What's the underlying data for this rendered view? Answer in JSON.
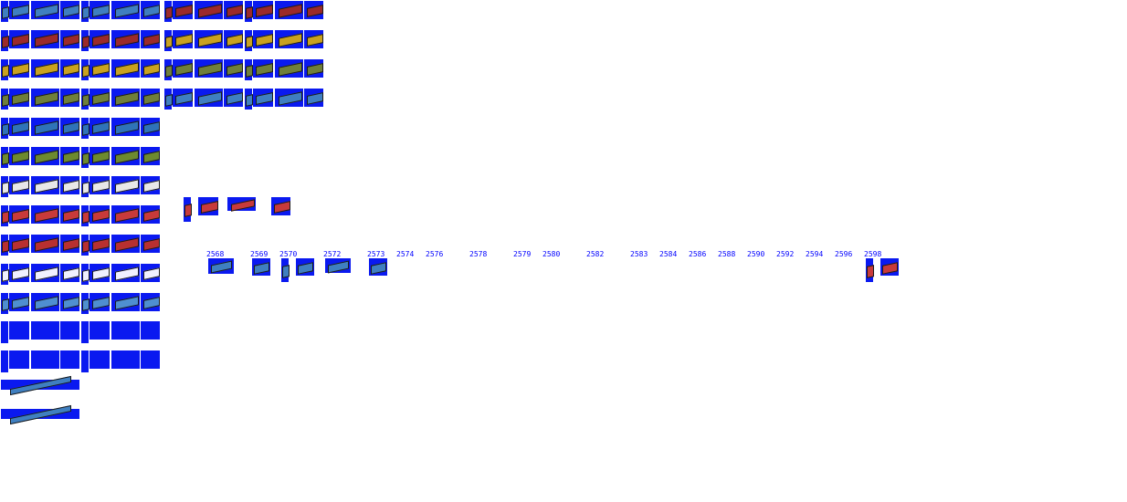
{
  "sprite_sheet": {
    "background_color": "#ffffff",
    "sprite_background_color": "#0a19f0",
    "label_color": "#0000ff",
    "sprite_index_labels": [
      "2568",
      "2569",
      "2570",
      "2572",
      "2573",
      "2574",
      "2576",
      "2578",
      "2579",
      "2580",
      "2582",
      "2583",
      "2584",
      "2586",
      "2588",
      "2590",
      "2592",
      "2594",
      "2596",
      "2598"
    ]
  }
}
